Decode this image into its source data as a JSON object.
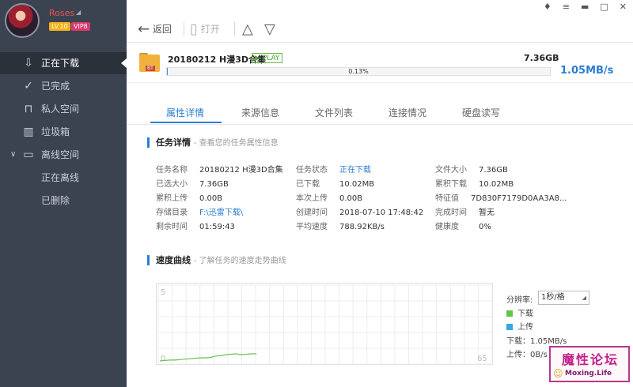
{
  "user": {
    "name": "Roses",
    "level_badge": "LV.10",
    "vip_badge": "VIP8"
  },
  "sidebar": {
    "items": [
      {
        "label": "正在下载",
        "icon": "download-icon"
      },
      {
        "label": "已完成",
        "icon": "check-circle-icon"
      },
      {
        "label": "私人空间",
        "icon": "lock-icon"
      },
      {
        "label": "垃圾箱",
        "icon": "trash-icon"
      },
      {
        "label": "离线空间",
        "icon": "cloud-monitor-icon"
      },
      {
        "label": "正在离线",
        "icon": ""
      },
      {
        "label": "已删除",
        "icon": ""
      }
    ]
  },
  "toolbar": {
    "back_label": "返回",
    "open_label": "打开"
  },
  "task": {
    "name": "20180212 H漫3D合集",
    "play_label": "PLAY",
    "size": "7.36GB",
    "progress_text": "0.13%",
    "progress_fraction": 0.0013,
    "speed": "1.05MB/s"
  },
  "tabs": [
    "属性详情",
    "来源信息",
    "文件列表",
    "连接情况",
    "硬盘读写"
  ],
  "details": {
    "title": "任务详情",
    "subtitle": "- 查看您的任务属性信息",
    "fields": [
      {
        "k": "任务名称",
        "v": "20180212 H漫3D合集"
      },
      {
        "k": "任务状态",
        "v": "正在下载"
      },
      {
        "k": "文件大小",
        "v": "7.36GB"
      },
      {
        "k": "已选大小",
        "v": "7.36GB"
      },
      {
        "k": "已下载",
        "v": "10.02MB"
      },
      {
        "k": "累积下载",
        "v": "10.02MB"
      },
      {
        "k": "累积上传",
        "v": "0.00B"
      },
      {
        "k": "本次上传",
        "v": "0.00B"
      },
      {
        "k": "特征值",
        "v": "7D830F7179D0AA3A8..."
      },
      {
        "k": "存储目录",
        "v": "F:\\迅雷下载\\"
      },
      {
        "k": "创建时间",
        "v": "2018-07-10 17:48:42"
      },
      {
        "k": "完成时间",
        "v": "暂无"
      },
      {
        "k": "剩余时间",
        "v": "01:59:43"
      },
      {
        "k": "平均速度",
        "v": "788.92KB/s"
      },
      {
        "k": "健康度",
        "v": "0%"
      }
    ]
  },
  "speed_section": {
    "title": "速度曲线",
    "subtitle": "- 了解任务的速度走势曲线",
    "resolution_label": "分辨率:",
    "resolution_value": "1秒/格",
    "legend_download": "下载",
    "legend_upload": "上传",
    "download_rate": "下载：1.05MB/s",
    "upload_rate": "上传：0B/s",
    "axis_top": "5",
    "axis_bottom": "0",
    "axis_right": "65",
    "colors": {
      "download": "#66c34a",
      "upload": "#35a6e6"
    }
  },
  "chart_data": {
    "type": "line",
    "series": [
      {
        "name": "下载",
        "x": [
          0,
          1,
          2,
          3,
          4,
          5,
          6,
          7,
          8,
          9,
          10,
          11,
          12,
          13,
          14,
          15,
          16,
          17,
          18,
          19
        ],
        "values": [
          0.0,
          0.05,
          0.1,
          0.1,
          0.15,
          0.2,
          0.25,
          0.3,
          0.35,
          0.35,
          0.4,
          0.55,
          0.6,
          0.7,
          0.75,
          0.8,
          0.7,
          0.75,
          0.8,
          0.8
        ]
      },
      {
        "name": "上传",
        "x": [
          0,
          19
        ],
        "values": [
          0,
          0
        ]
      }
    ],
    "ylim": [
      0,
      5
    ],
    "xlim": [
      0,
      65
    ],
    "grid": true
  },
  "watermark": {
    "title": "魔性论坛",
    "site": "Moxing.Life"
  }
}
